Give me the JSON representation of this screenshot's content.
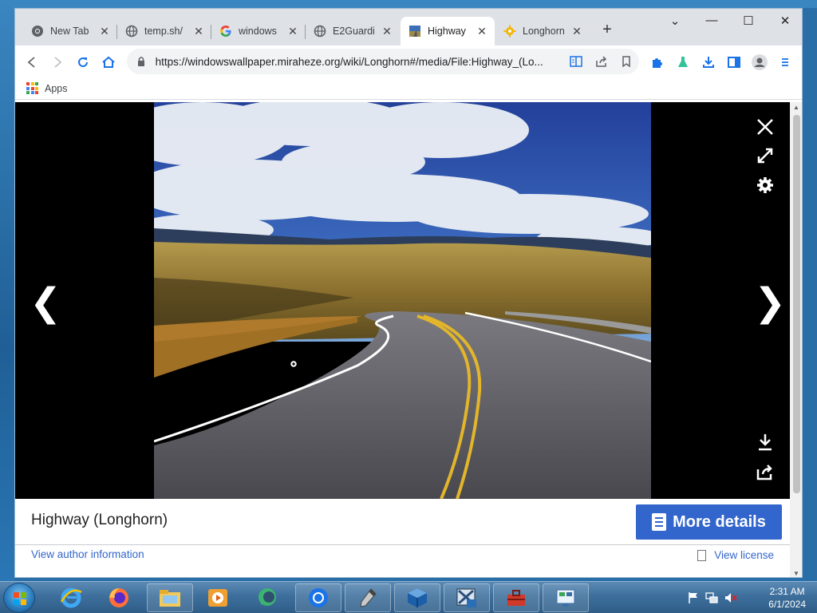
{
  "browser": {
    "tabs": [
      {
        "label": "New Tab",
        "icon": "chrome-icon"
      },
      {
        "label": "temp.sh/",
        "icon": "globe-icon"
      },
      {
        "label": "windows",
        "icon": "google-icon"
      },
      {
        "label": "E2Guardi",
        "icon": "globe-icon"
      },
      {
        "label": "Highway",
        "icon": "highway-favicon",
        "active": true
      },
      {
        "label": "Longhorn",
        "icon": "gear-favicon"
      }
    ],
    "new_tab_symbol": "+",
    "window_controls": {
      "menu": "⌄",
      "minimize": "—",
      "maximize": "☐",
      "close": "✕"
    },
    "url": "https://windowswallpaper.miraheze.org/wiki/Longhorn#/media/File:Highway_(Lo...",
    "bookmarks": {
      "apps_label": "Apps"
    }
  },
  "viewer": {
    "title": "Highway (Longhorn)",
    "more_details_label": "More details",
    "author_link": "View author information",
    "license_link": "View license",
    "prev_arrow": "❮",
    "next_arrow": "❯"
  },
  "taskbar": {
    "time": "2:31 AM",
    "date": "6/1/2024"
  },
  "colors": {
    "accent": "#3366cc",
    "link": "#3366cc",
    "tab_strip": "#dee1e6"
  }
}
